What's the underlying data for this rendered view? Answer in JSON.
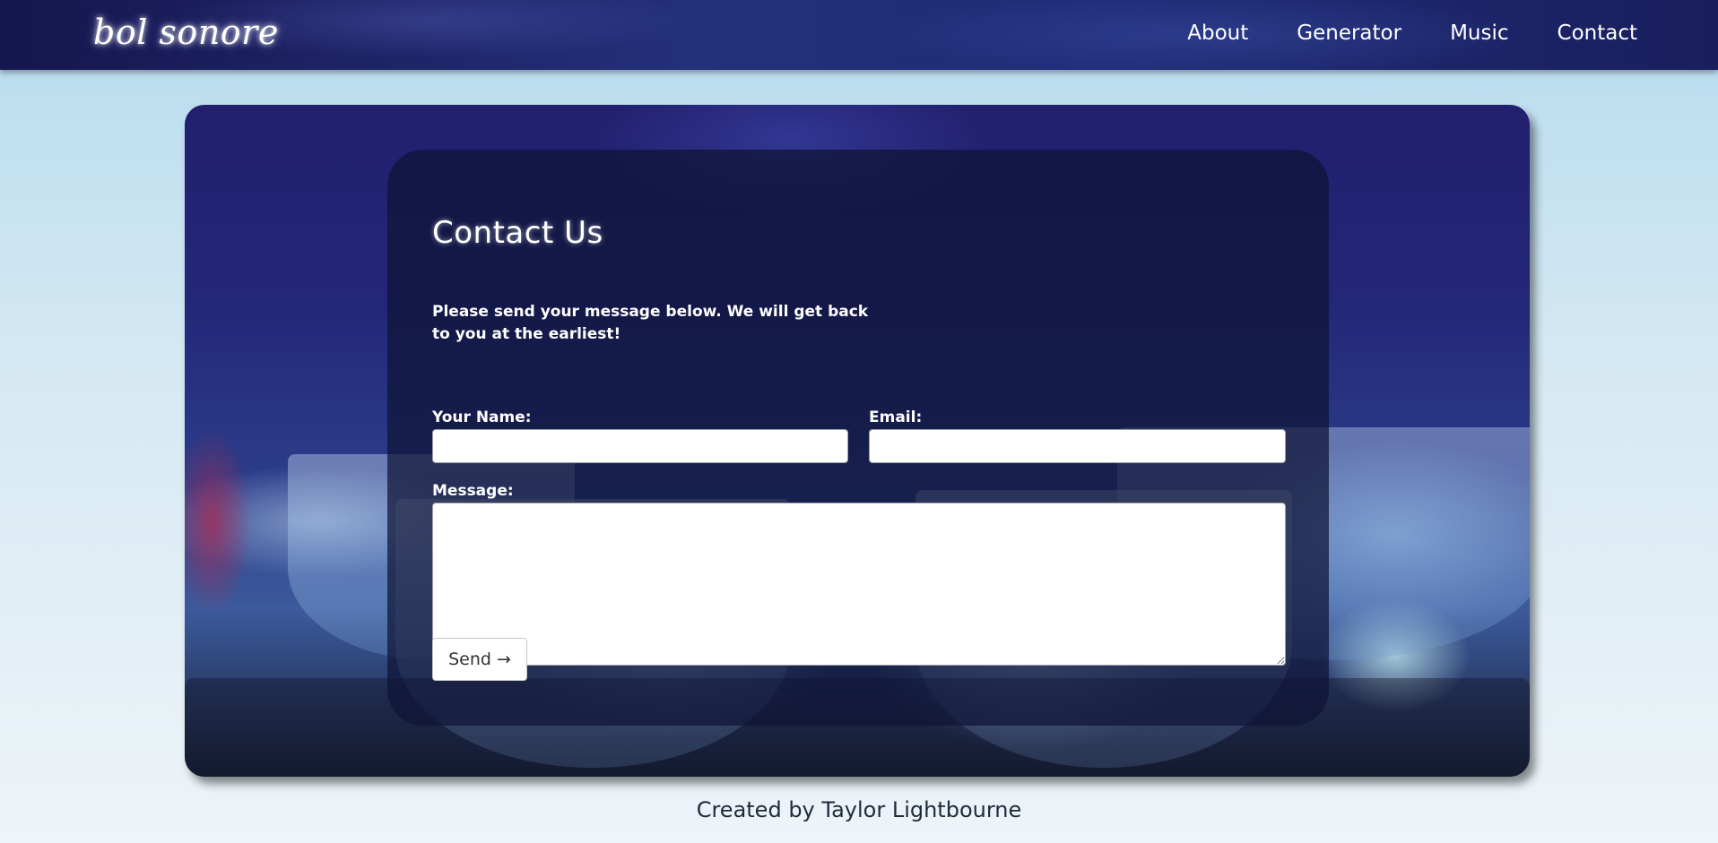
{
  "nav": {
    "brand": "bol sonore",
    "links": [
      "About",
      "Generator",
      "Music",
      "Contact"
    ]
  },
  "contact": {
    "title": "Contact Us",
    "description": "Please send your message below. We will get back to you at the earliest!",
    "name_label": "Your Name:",
    "name_value": "",
    "email_label": "Email:",
    "email_value": "",
    "message_label": "Message:",
    "message_value": "",
    "send_label": "Send →"
  },
  "footer": {
    "text": "Created by Taylor Lightbourne"
  },
  "colors": {
    "nav_bg": "#1e2c78",
    "page_bg_top": "#b6dbef",
    "page_bg_bottom": "#eef4f8",
    "card_bg": "#0e1434",
    "text_light": "#ffffff",
    "footer_text": "#1f2a3a"
  }
}
